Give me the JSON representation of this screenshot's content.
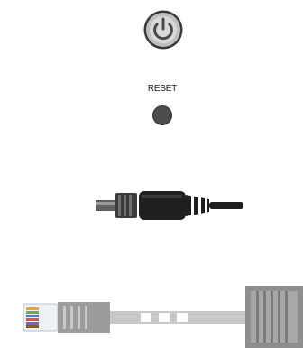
{
  "controls": {
    "power_icon": "power-icon",
    "reset_label": "RESET",
    "reset_icon": "reset-button"
  },
  "connectors": {
    "dc_power_plug": "dc-power-plug",
    "ethernet_cable": "rj45-ethernet-cable"
  },
  "colors": {
    "power_ring": "#3a3a3a",
    "power_face": "#cfcfcf",
    "reset_button": "#4d4d4f",
    "plug_body": "#2b2b2b",
    "plug_metal": "#6b6b6b",
    "cable_grey": "#bdbdbd",
    "rj45_wires": [
      "#e8a33d",
      "#59b35a",
      "#3f7fd0",
      "#e05050",
      "#8a5cb8",
      "#f0d040",
      "#ffffff",
      "#8b5a2b"
    ]
  }
}
